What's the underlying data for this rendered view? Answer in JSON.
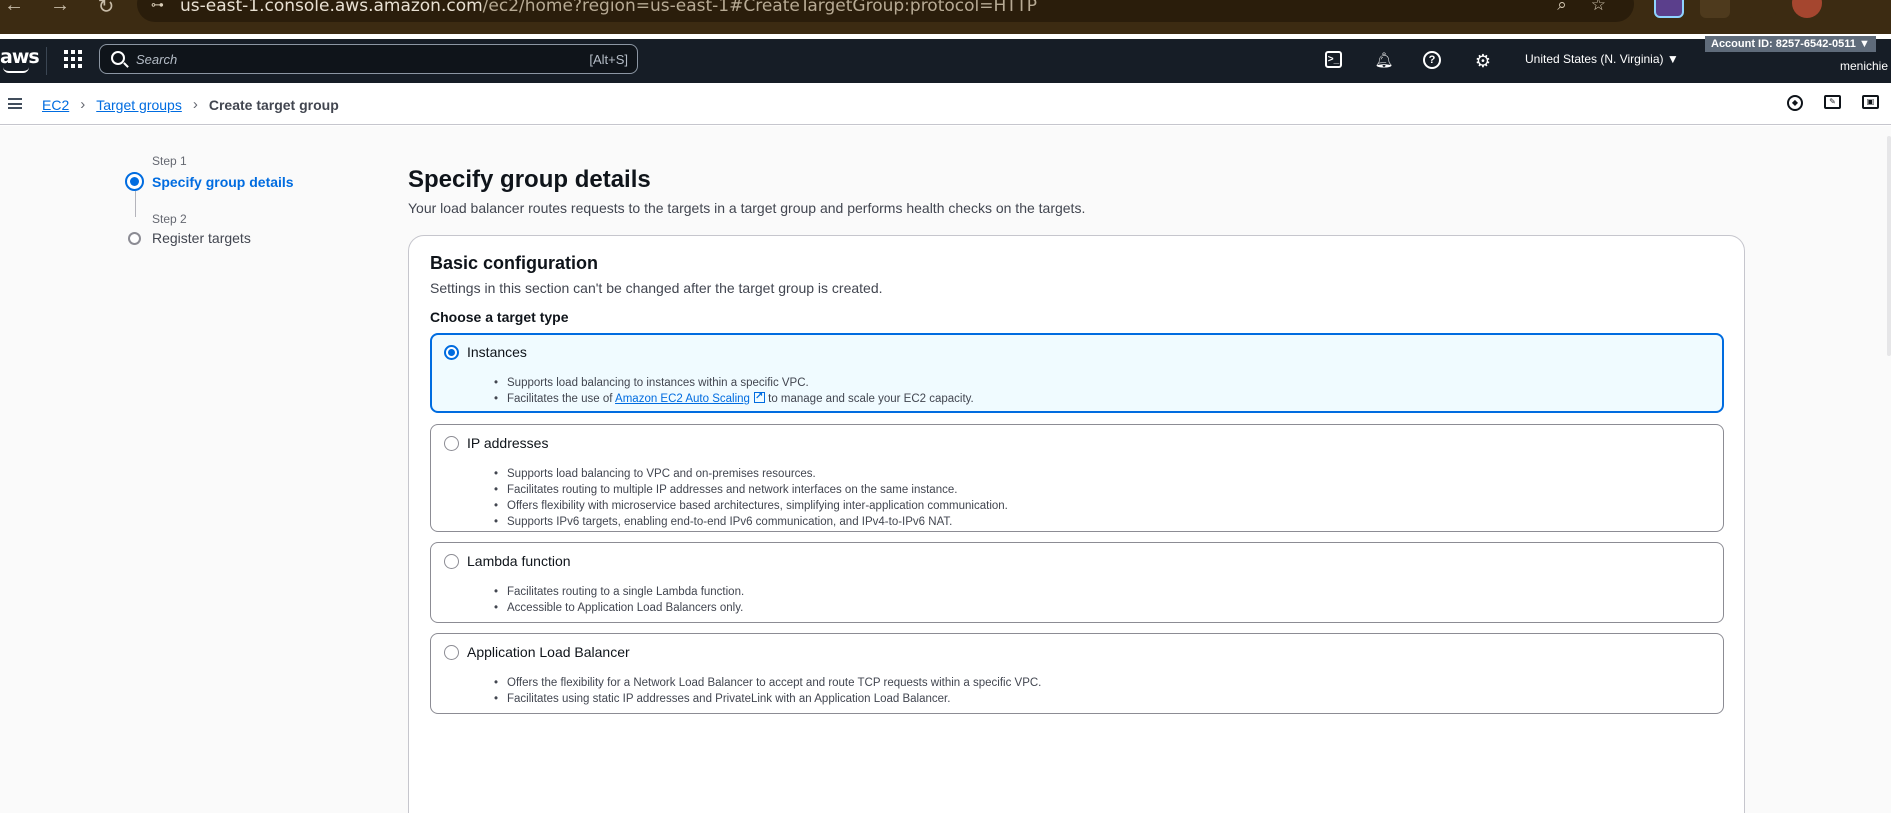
{
  "browser": {
    "url_host": "us-east-1.console.aws.amazon.com",
    "url_path": "/ec2/home?region=us-east-1#CreateTargetGroup:protocol=HTTP"
  },
  "topnav": {
    "logo": "aws",
    "search_placeholder": "Search",
    "search_shortcut": "[Alt+S]",
    "region": "United States (N. Virginia) ▼",
    "account": "Account ID: 8257-6542-0511 ▼",
    "username": "menichie"
  },
  "breadcrumb": {
    "items": [
      "EC2",
      "Target groups"
    ],
    "current": "Create target group"
  },
  "steps": [
    {
      "number": "Step 1",
      "label": "Specify group details"
    },
    {
      "number": "Step 2",
      "label": "Register targets"
    }
  ],
  "page": {
    "title": "Specify group details",
    "description": "Your load balancer routes requests to the targets in a target group and performs health checks on the targets."
  },
  "basic_config": {
    "title": "Basic configuration",
    "description": "Settings in this section can't be changed after the target group is created.",
    "target_type_label": "Choose a target type",
    "options": [
      {
        "title": "Instances",
        "bullets": [
          "Supports load balancing to instances within a specific VPC."
        ],
        "link_bullet": {
          "before": "Facilitates the use of ",
          "link": "Amazon EC2 Auto Scaling",
          "after": " to manage and scale your EC2 capacity."
        }
      },
      {
        "title": "IP addresses",
        "bullets": [
          "Supports load balancing to VPC and on-premises resources.",
          "Facilitates routing to multiple IP addresses and network interfaces on the same instance.",
          "Offers flexibility with microservice based architectures, simplifying inter-application communication.",
          "Supports IPv6 targets, enabling end-to-end IPv6 communication, and IPv4-to-IPv6 NAT."
        ]
      },
      {
        "title": "Lambda function",
        "bullets": [
          "Facilitates routing to a single Lambda function.",
          "Accessible to Application Load Balancers only."
        ]
      },
      {
        "title": "Application Load Balancer",
        "bullets": [
          "Offers the flexibility for a Network Load Balancer to accept and route TCP requests within a specific VPC.",
          "Facilitates using static IP addresses and PrivateLink with an Application Load Balancer."
        ]
      }
    ]
  }
}
